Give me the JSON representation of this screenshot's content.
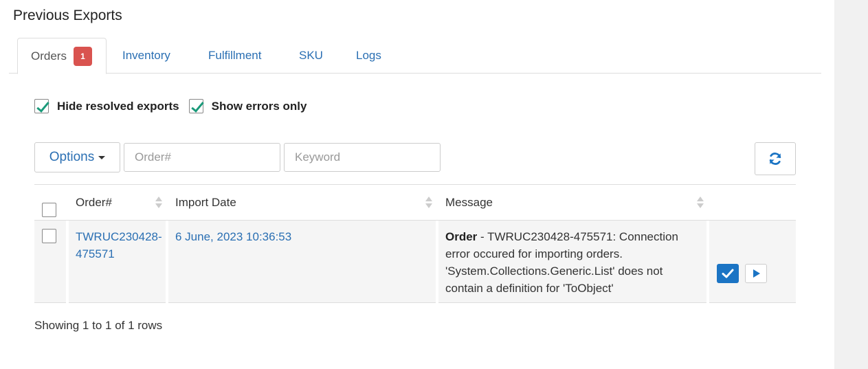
{
  "page": {
    "title": "Previous Exports"
  },
  "tabs": [
    {
      "label": "Orders",
      "badge": "1",
      "active": true
    },
    {
      "label": "Inventory"
    },
    {
      "label": "Fulfillment"
    },
    {
      "label": "SKU"
    },
    {
      "label": "Logs"
    }
  ],
  "filters": {
    "hide_resolved": {
      "label": "Hide resolved exports",
      "checked": true
    },
    "errors_only": {
      "label": "Show errors only",
      "checked": true
    }
  },
  "toolbar": {
    "options_label": "Options",
    "order_placeholder": "Order#",
    "keyword_placeholder": "Keyword"
  },
  "table": {
    "columns": [
      "Order#",
      "Import Date",
      "Message"
    ],
    "rows": [
      {
        "order_line1": "TWRUC230428-",
        "order_line2": "475571",
        "import_date": "6 June, 2023 10:36:53",
        "message_strong": "Order",
        "message_rest": " - TWRUC230428-475571: Connection error occured for importing orders. 'System.Collections.Generic.List' does not contain a definition for 'ToObject'"
      }
    ]
  },
  "footer": {
    "summary": "Showing 1 to 1 of 1 rows"
  },
  "colors": {
    "link": "#2a6fb3",
    "badge": "#d9534f",
    "primary": "#1b74c4",
    "check": "#1a9a7a"
  },
  "icons": [
    "refresh-icon",
    "check-icon",
    "play-icon",
    "sort-icon",
    "caret-down-icon"
  ]
}
